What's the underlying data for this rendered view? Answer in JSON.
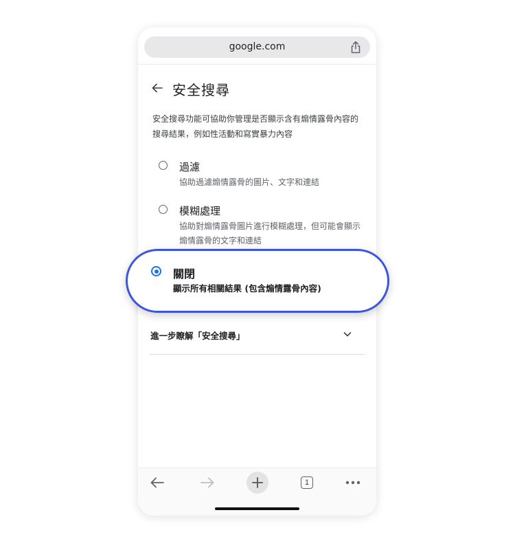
{
  "browser": {
    "url": "google.com",
    "icons": {
      "share": "share-icon"
    }
  },
  "header": {
    "title": "安全搜尋",
    "back_icon": "back-arrow-icon"
  },
  "description": "安全搜尋功能可協助你管理是否顯示含有煽情露骨內容的搜尋結果，例如性活動和寫實暴力內容",
  "options": [
    {
      "title": "過濾",
      "description": "協助過濾煽情露骨的圖片、文字和連結",
      "selected": false
    },
    {
      "title": "模糊處理",
      "description": "協助對煽情露骨圖片進行模糊處理，但可能會顯示煽情露骨的文字和連結",
      "selected": false
    },
    {
      "title": "關閉",
      "description": "顯示所有相關結果 (包含煽情露骨內容)",
      "selected": true
    }
  ],
  "learn_more": {
    "label": "進一步瞭解「安全搜尋」",
    "icon": "chevron-down-icon"
  },
  "toolbar": {
    "tab_count": "1",
    "icons": [
      "back-icon",
      "forward-icon",
      "new-tab-icon",
      "tab-switcher-icon",
      "more-icon"
    ]
  },
  "colors": {
    "accent": "#1a73e8",
    "highlight_ring": "#3c55e0"
  }
}
